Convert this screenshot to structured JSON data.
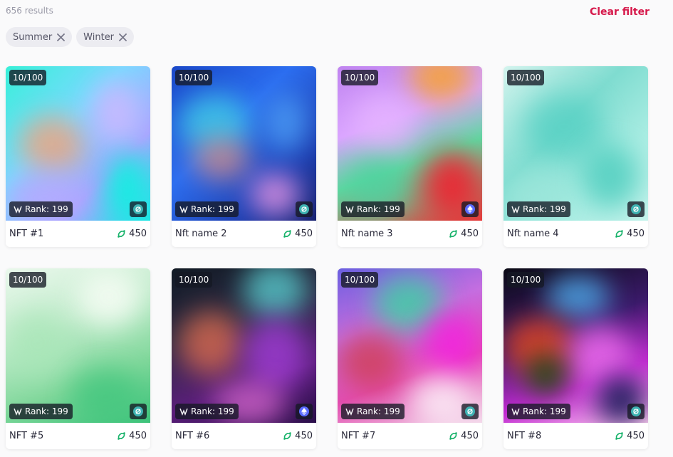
{
  "header": {
    "results_text": "656 results",
    "clear_filter_label": "Clear filter"
  },
  "filters": [
    {
      "label": "Summer"
    },
    {
      "label": "Winter"
    }
  ],
  "colors": {
    "accent": "#d6194b",
    "price_icon": "#17b26a",
    "icon_chain_teal": "#3fb3b3",
    "icon_chain_eth": "#5a6bff"
  },
  "cards": [
    {
      "name": "NFT #1",
      "edition": "10/100",
      "rank": "Rank: 199",
      "price": "450",
      "chain_icon": "icon-chain-icon"
    },
    {
      "name": "Nft name 2",
      "edition": "10/100",
      "rank": "Rank: 199",
      "price": "450",
      "chain_icon": "icon-chain-icon"
    },
    {
      "name": "Nft name 3",
      "edition": "10/100",
      "rank": "Rank: 199",
      "price": "450",
      "chain_icon": "ethereum-icon"
    },
    {
      "name": "Nft name 4",
      "edition": "10/100",
      "rank": "Rank: 199",
      "price": "450",
      "chain_icon": "icon-chain-icon"
    },
    {
      "name": "NFT #5",
      "edition": "10/100",
      "rank": "Rank: 199",
      "price": "450",
      "chain_icon": "icon-chain-icon"
    },
    {
      "name": "NFT #6",
      "edition": "10/100",
      "rank": "Rank: 199",
      "price": "450",
      "chain_icon": "ethereum-icon"
    },
    {
      "name": "NFT #7",
      "edition": "10/100",
      "rank": "Rank: 199",
      "price": "450",
      "chain_icon": "icon-chain-icon"
    },
    {
      "name": "NFT #8",
      "edition": "10/100",
      "rank": "Rank: 199",
      "price": "450",
      "chain_icon": "icon-chain-icon"
    }
  ]
}
